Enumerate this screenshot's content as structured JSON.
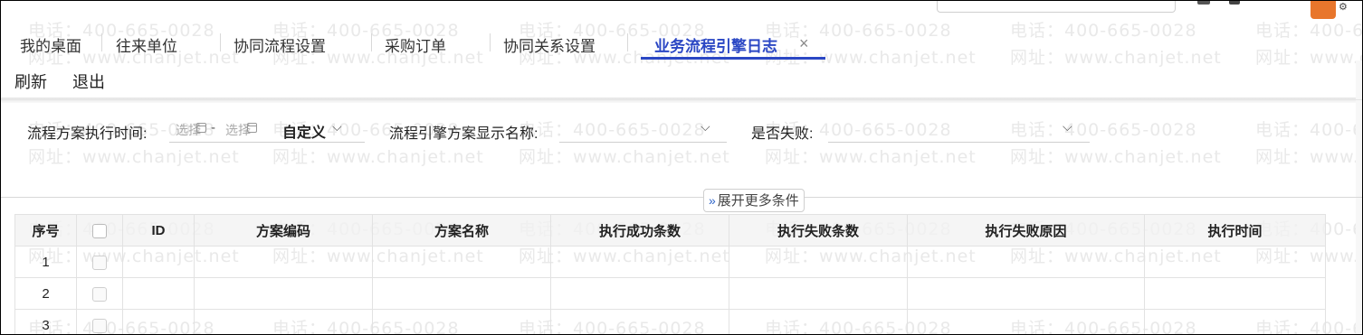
{
  "tabs": [
    {
      "label": "我的桌面"
    },
    {
      "label": "往来单位"
    },
    {
      "label": "协同流程设置"
    },
    {
      "label": "采购订单"
    },
    {
      "label": "协同关系设置"
    },
    {
      "label": "业务流程引擎日志",
      "active": true
    }
  ],
  "toolbar": {
    "refresh": "刷新",
    "exit": "退出"
  },
  "filters": {
    "exec_time_label": "流程方案执行时间:",
    "date_from_placeholder": "选择",
    "date_to_placeholder": "选择",
    "date_separator": "-",
    "range_value": "自定义",
    "scheme_name_label": "流程引擎方案显示名称:",
    "failed_label": "是否失败:",
    "expand_more": "展开更多条件"
  },
  "table": {
    "columns": [
      "序号",
      "",
      "ID",
      "方案编码",
      "方案名称",
      "执行成功条数",
      "执行失败条数",
      "执行失败原因",
      "执行时间"
    ],
    "rows": [
      {
        "index": "1"
      },
      {
        "index": "2"
      },
      {
        "index": "3"
      }
    ]
  },
  "watermark": {
    "phone": "电话：400-665-0028",
    "site": "网址：www.chanjet.net"
  },
  "colors": {
    "accent": "#2b47c4",
    "border": "#e2e2e2",
    "brand_orange": "#e8762c"
  }
}
